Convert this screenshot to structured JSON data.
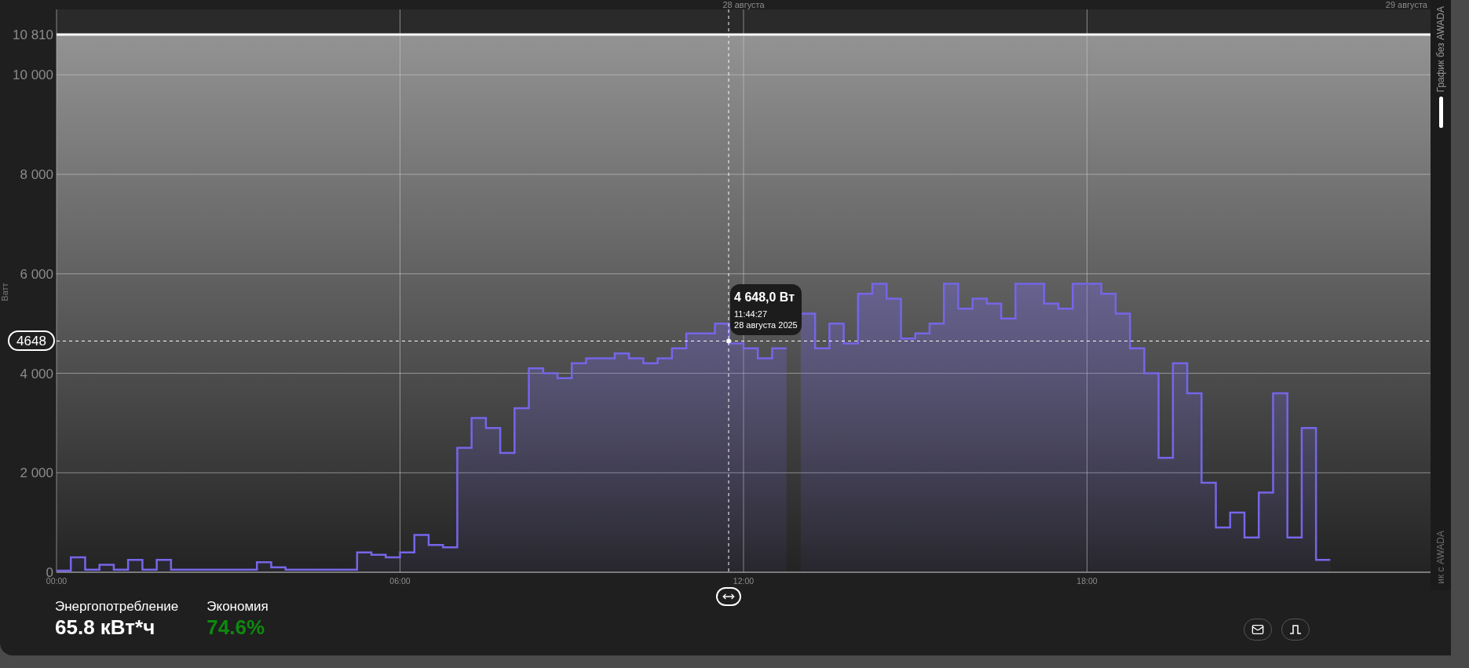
{
  "chart_panel": {
    "chart_data": {
      "type": "area",
      "ylabel": "Ватт",
      "grid": true,
      "xlim": [
        0,
        24
      ],
      "ylim": [
        0,
        10810
      ],
      "xticks": [
        {
          "value": 0,
          "label": "00:00"
        },
        {
          "value": 6,
          "label": "06:00"
        },
        {
          "value": 12,
          "label": "12:00"
        },
        {
          "value": 18,
          "label": "18:00"
        }
      ],
      "yticks": [
        {
          "value": 0,
          "label": "0"
        },
        {
          "value": 2000,
          "label": "2 000"
        },
        {
          "value": 4000,
          "label": "4 000"
        },
        {
          "value": 6000,
          "label": "6 000"
        },
        {
          "value": 8000,
          "label": "8 000"
        },
        {
          "value": 10000,
          "label": "10 000"
        }
      ],
      "ref_lines": [
        {
          "axis": "y",
          "value": 10810,
          "label": "10 810"
        },
        {
          "axis": "y",
          "value": 4648,
          "label": "4648"
        },
        {
          "axis": "x",
          "value": 11.74
        }
      ],
      "x": [
        0,
        0.25,
        0.25,
        0.5,
        0.5,
        0.75,
        0.75,
        1,
        1,
        1.25,
        1.25,
        1.5,
        1.5,
        1.75,
        1.75,
        2,
        2,
        2.25,
        2.25,
        2.5,
        2.5,
        2.75,
        2.75,
        3,
        3,
        3.25,
        3.25,
        3.5,
        3.5,
        3.75,
        3.75,
        4,
        4,
        4.25,
        4.25,
        4.5,
        4.5,
        4.75,
        4.75,
        5,
        5,
        5.25,
        5.25,
        5.5,
        5.5,
        5.75,
        5.75,
        6,
        6,
        6.25,
        6.25,
        6.5,
        6.5,
        6.75,
        6.75,
        7,
        7,
        7.25,
        7.25,
        7.5,
        7.5,
        7.75,
        7.75,
        8,
        8,
        8.25,
        8.25,
        8.5,
        8.5,
        8.75,
        8.75,
        9,
        9,
        9.25,
        9.25,
        9.5,
        9.5,
        9.75,
        9.75,
        10,
        10,
        10.25,
        10.25,
        10.5,
        10.5,
        10.75,
        10.75,
        11,
        11,
        11.25,
        11.25,
        11.5,
        11.5,
        11.75,
        11.75,
        12,
        12,
        12.25,
        12.25,
        12.5,
        12.5,
        12.75,
        13,
        13.25,
        13.25,
        13.5,
        13.5,
        13.75,
        13.75,
        14,
        14,
        14.25,
        14.25,
        14.5,
        14.5,
        14.75,
        14.75,
        15,
        15,
        15.25,
        15.25,
        15.5,
        15.5,
        15.75,
        15.75,
        16,
        16,
        16.25,
        16.25,
        16.5,
        16.5,
        16.75,
        16.75,
        17,
        17,
        17.25,
        17.25,
        17.5,
        17.5,
        17.75,
        17.75,
        18,
        18,
        18.25,
        18.25,
        18.5,
        18.5,
        18.75,
        18.75,
        19,
        19,
        19.25,
        19.25,
        19.5,
        19.5,
        19.75,
        19.75,
        20,
        20,
        20.25,
        20.25,
        20.5,
        20.5,
        20.75,
        20.75,
        21,
        21,
        21.25,
        21.25,
        21.5,
        21.5,
        21.75,
        21.75,
        22,
        22,
        22.25
      ],
      "series": [
        {
          "color": "#7566e8",
          "values": [
            30,
            30,
            300,
            300,
            50,
            50,
            150,
            150,
            50,
            50,
            250,
            250,
            50,
            50,
            250,
            250,
            50,
            50,
            50,
            50,
            50,
            50,
            50,
            50,
            50,
            50,
            50,
            50,
            200,
            200,
            100,
            100,
            50,
            50,
            50,
            50,
            50,
            50,
            50,
            50,
            50,
            50,
            400,
            400,
            350,
            350,
            300,
            300,
            400,
            400,
            750,
            750,
            550,
            550,
            500,
            500,
            2500,
            2500,
            3100,
            3100,
            2900,
            2900,
            2400,
            2400,
            3300,
            3300,
            4100,
            4100,
            4000,
            4000,
            3900,
            3900,
            4200,
            4200,
            4300,
            4300,
            4300,
            4300,
            4400,
            4400,
            4300,
            4300,
            4200,
            4200,
            4300,
            4300,
            4500,
            4500,
            4800,
            4800,
            4800,
            4800,
            5000,
            5000,
            4600,
            4600,
            4500,
            4500,
            4300,
            4300,
            4500,
            4500,
            5200,
            5200,
            4500,
            4500,
            5000,
            5000,
            4600,
            4600,
            5600,
            5600,
            5800,
            5800,
            5500,
            5500,
            4700,
            4700,
            4800,
            4800,
            5000,
            5000,
            5800,
            5800,
            5300,
            5300,
            5500,
            5500,
            5400,
            5400,
            5100,
            5100,
            5800,
            5800,
            5800,
            5800,
            5400,
            5400,
            5300,
            5300,
            5800,
            5800,
            5800,
            5800,
            5600,
            5600,
            5200,
            5200,
            4500,
            4500,
            4000,
            4000,
            2300,
            2300,
            4200,
            4200,
            3600,
            3600,
            1800,
            1800,
            900,
            900,
            1200,
            1200,
            700,
            700,
            1600,
            1600,
            3600,
            3600,
            700,
            700,
            2900,
            2900,
            250,
            250
          ]
        }
      ]
    },
    "date_labels": [
      "28 августа",
      "29 августа"
    ],
    "tooltip": {
      "value": "4 648,0 Вт",
      "time": "11:44:27",
      "date": "28 августа 2025"
    },
    "mode_switch": [
      {
        "label": "График без AWADA",
        "selected": true
      },
      {
        "label": "ик с AWADA",
        "selected": false
      }
    ]
  },
  "stats": [
    {
      "label": "Энергопотребление",
      "value": "65.8 кВт*ч",
      "kind": "neutral"
    },
    {
      "label": "Экономия",
      "value": "74.6%",
      "kind": "positive"
    }
  ],
  "buttons": [
    {
      "kind": "mail"
    },
    {
      "kind": "pulse"
    }
  ]
}
